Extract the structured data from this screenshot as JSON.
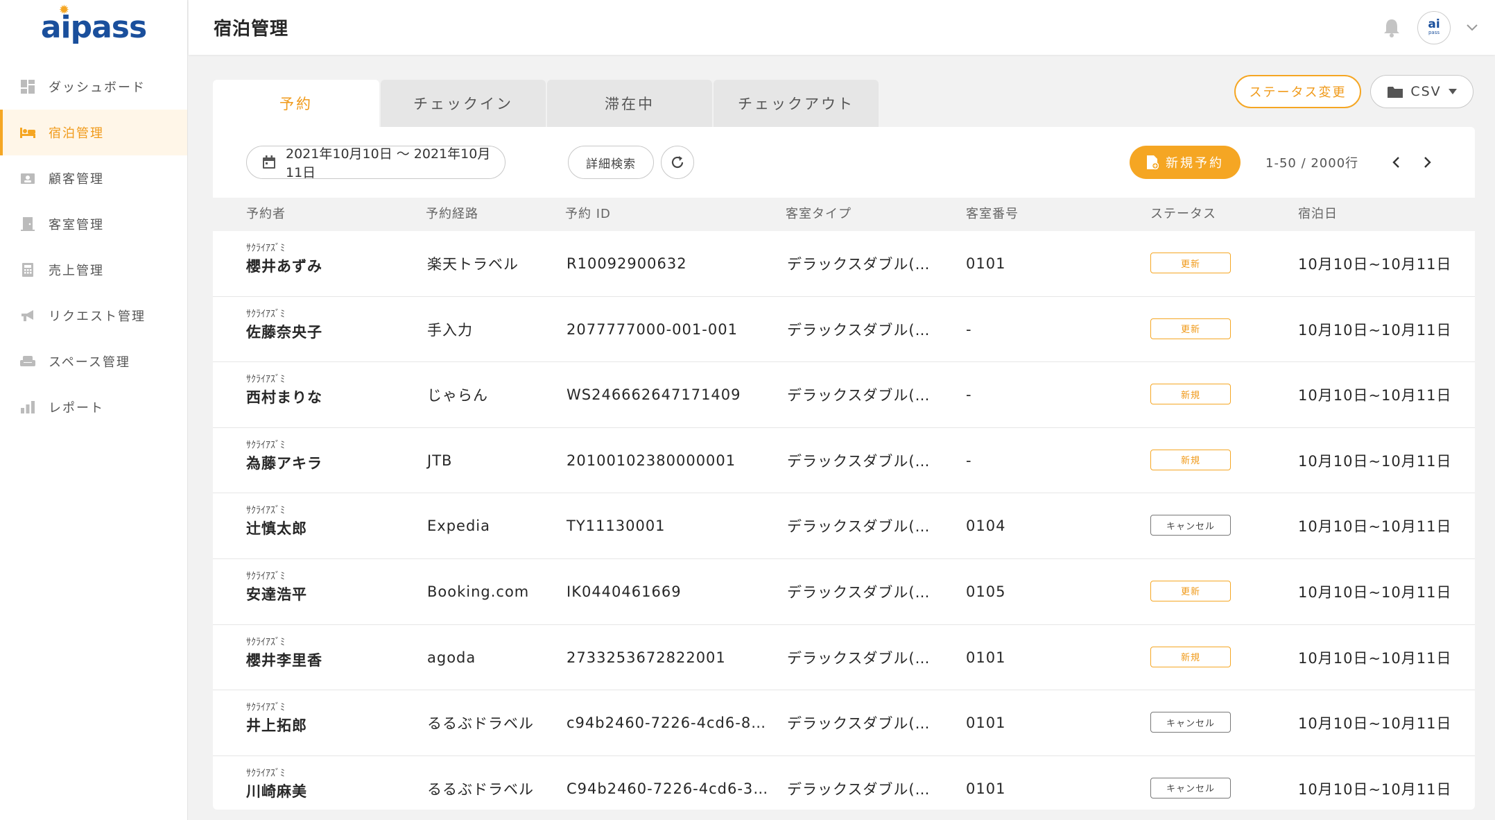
{
  "brand": {
    "logo_text": "aipass"
  },
  "sidebar": {
    "items": [
      {
        "label": "ダッシュボード",
        "icon": "dashboard-icon",
        "active": false
      },
      {
        "label": "宿泊管理",
        "icon": "bed-icon",
        "active": true
      },
      {
        "label": "顧客管理",
        "icon": "contact-card-icon",
        "active": false
      },
      {
        "label": "客室管理",
        "icon": "door-icon",
        "active": false
      },
      {
        "label": "売上管理",
        "icon": "calculator-icon",
        "active": false
      },
      {
        "label": "リクエスト管理",
        "icon": "megaphone-icon",
        "active": false
      },
      {
        "label": "スペース管理",
        "icon": "armchair-icon",
        "active": false
      },
      {
        "label": "レポート",
        "icon": "bar-chart-icon",
        "active": false
      }
    ]
  },
  "header": {
    "title": "宿泊管理",
    "avatar_top": "ai",
    "avatar_bottom": "pass"
  },
  "tabs": [
    "予約",
    "チェックイン",
    "滞在中",
    "チェックアウト"
  ],
  "actions": {
    "status_change": "ステータス変更",
    "csv": "CSV"
  },
  "toolbar": {
    "date_range": "2021年10月10日 ～ 2021年10月11日",
    "detail_search": "詳細検索",
    "new_reservation": "新規予約",
    "pagination": "1-50 / 2000行"
  },
  "table": {
    "columns": [
      "予約者",
      "予約経路",
      "予約 ID",
      "客室タイプ",
      "客室番号",
      "ステータス",
      "宿泊日"
    ],
    "rows": [
      {
        "kana": "ｻｸﾗｲｱｽﾞﾐ",
        "name": "櫻井あずみ",
        "route": "楽天トラベル",
        "id": "R10092900632",
        "room_type": "デラックスダブル(…",
        "room_no": "0101",
        "status": "更新",
        "status_color": "#f5a623",
        "dates": "10月10日~10月11日"
      },
      {
        "kana": "ｻｸﾗｲｱｽﾞﾐ",
        "name": "佐藤奈央子",
        "route": "手入力",
        "id": "2077777000-001-001",
        "room_type": "デラックスダブル(…",
        "room_no": "-",
        "status": "更新",
        "status_color": "#f5a623",
        "dates": "10月10日~10月11日"
      },
      {
        "kana": "ｻｸﾗｲｱｽﾞﾐ",
        "name": "西村まりな",
        "route": "じゃらん",
        "id": "WS246662647171409",
        "room_type": "デラックスダブル(…",
        "room_no": "-",
        "status": "新規",
        "status_color": "#f5a623",
        "dates": "10月10日~10月11日"
      },
      {
        "kana": "ｻｸﾗｲｱｽﾞﾐ",
        "name": "為藤アキラ",
        "route": "JTB",
        "id": "20100102380000001",
        "room_type": "デラックスダブル(…",
        "room_no": "-",
        "status": "新規",
        "status_color": "#f5a623",
        "dates": "10月10日~10月11日"
      },
      {
        "kana": "ｻｸﾗｲｱｽﾞﾐ",
        "name": "辻慎太郎",
        "route": "Expedia",
        "id": "TY11130001",
        "room_type": "デラックスダブル(…",
        "room_no": "0104",
        "status": "キャンセル",
        "status_color": "#777777",
        "dates": "10月10日~10月11日"
      },
      {
        "kana": "ｻｸﾗｲｱｽﾞﾐ",
        "name": "安達浩平",
        "route": "Booking.com",
        "id": "IK0440461669",
        "room_type": "デラックスダブル(…",
        "room_no": "0105",
        "status": "更新",
        "status_color": "#f5a623",
        "dates": "10月10日~10月11日"
      },
      {
        "kana": "ｻｸﾗｲｱｽﾞﾐ",
        "name": "櫻井李里香",
        "route": "agoda",
        "id": "2733253672822001",
        "room_type": "デラックスダブル(…",
        "room_no": "0101",
        "status": "新規",
        "status_color": "#f5a623",
        "dates": "10月10日~10月11日"
      },
      {
        "kana": "ｻｸﾗｲｱｽﾞﾐ",
        "name": "井上拓郎",
        "route": "るるぶドラベル",
        "id": "c94b2460-7226-4cd6-8…",
        "room_type": "デラックスダブル(…",
        "room_no": "0101",
        "status": "キャンセル",
        "status_color": "#777777",
        "dates": "10月10日~10月11日"
      },
      {
        "kana": "ｻｸﾗｲｱｽﾞﾐ",
        "name": "川崎麻美",
        "route": "るるぶドラベル",
        "id": "C94b2460-7226-4cd6-3…",
        "room_type": "デラックスダブル(…",
        "room_no": "0101",
        "status": "キャンセル",
        "status_color": "#777777",
        "dates": "10月10日~10月11日"
      }
    ]
  },
  "colors": {
    "accent": "#f5a623",
    "brand": "#1a4f9c"
  }
}
